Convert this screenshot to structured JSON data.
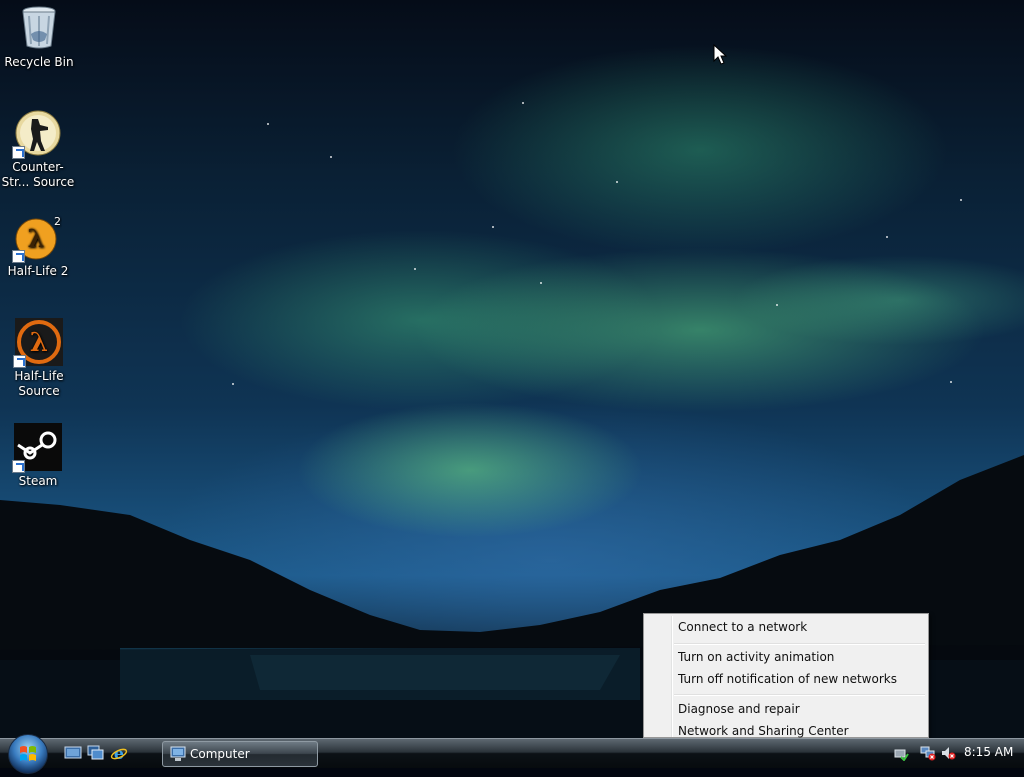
{
  "desktop": {
    "icons": [
      {
        "label": "Recycle Bin",
        "icon": "recycle-bin-icon"
      },
      {
        "label": "Counter-Str... Source",
        "icon": "counter-strike-icon"
      },
      {
        "label": "Half-Life 2",
        "icon": "half-life-2-icon"
      },
      {
        "label": "Half-Life Source",
        "icon": "half-life-source-icon"
      },
      {
        "label": "Steam",
        "icon": "steam-icon"
      }
    ]
  },
  "context_menu": {
    "items": [
      {
        "label": "Connect to a network"
      },
      {
        "label": "Turn on activity animation"
      },
      {
        "label": "Turn off notification of new networks"
      },
      {
        "label": "Diagnose and repair"
      },
      {
        "label": "Network and Sharing Center"
      }
    ]
  },
  "taskbar": {
    "quick_launch": [
      "show-desktop-icon",
      "switch-windows-icon",
      "internet-explorer-icon"
    ],
    "windows": [
      {
        "label": "Computer",
        "icon": "computer-icon"
      }
    ],
    "tray": {
      "icons": [
        "safely-remove-hardware-icon",
        "network-disconnected-icon",
        "volume-muted-icon"
      ],
      "clock": "8:15 AM"
    }
  },
  "colors": {
    "aurora_green": "#5fd78a",
    "sky_blue": "#1c5a8a",
    "menu_background": "#f0f0f0",
    "taskbar_dark": "#0c1116"
  }
}
